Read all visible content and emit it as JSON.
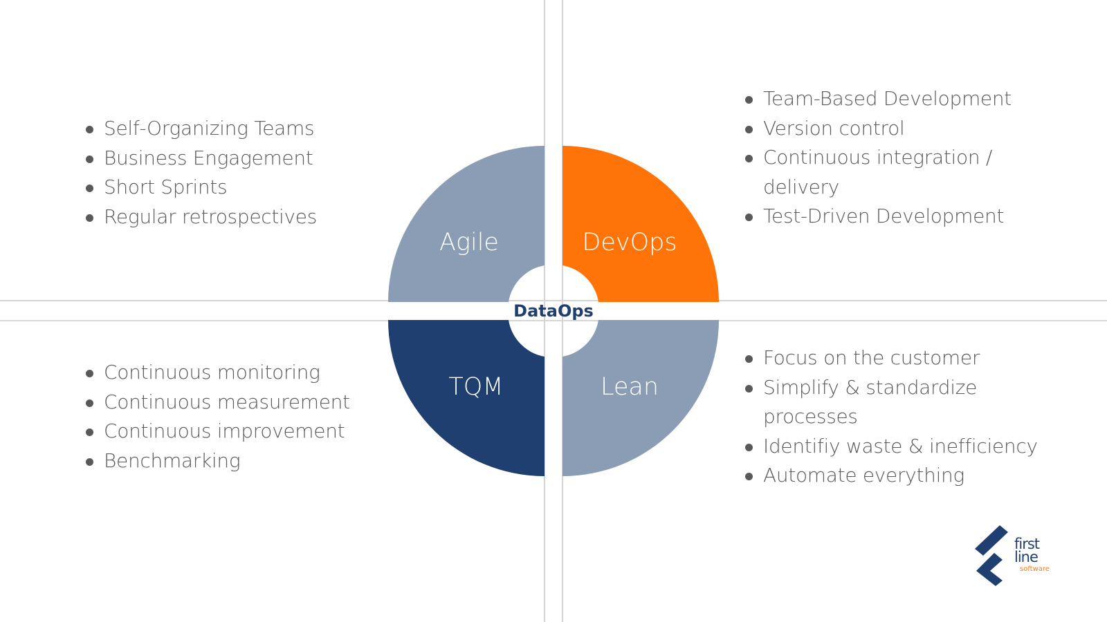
{
  "diagram": {
    "center": "DataOps",
    "quadrants": [
      {
        "name": "Agile",
        "color": "#8a9db4",
        "position": "top-left",
        "items": [
          "Self-Organizing Teams",
          "Business Engagement",
          "Short Sprints",
          "Regular retrospectives"
        ]
      },
      {
        "name": "DevOps",
        "color": "#ff7408",
        "position": "top-right",
        "items": [
          "Team-Based Development",
          "Version control",
          "Continuous integration / delivery",
          "Test-Driven Development"
        ]
      },
      {
        "name": "TQM",
        "color": "#1e3f6f",
        "position": "bottom-left",
        "items": [
          "Continuous monitoring",
          "Continuous measurement",
          "Continuous improvement",
          "Benchmarking"
        ]
      },
      {
        "name": "Lean",
        "color": "#8a9db4",
        "position": "bottom-right",
        "items": [
          "Focus on the customer",
          "Simplify & standardize processes",
          "Identifiy waste & inefficiency",
          "Automate everything"
        ]
      }
    ]
  },
  "logo": {
    "line1": "first",
    "line2": "line",
    "sub": "software",
    "primary_color": "#1e3f6f",
    "accent_color": "#f57c10"
  }
}
